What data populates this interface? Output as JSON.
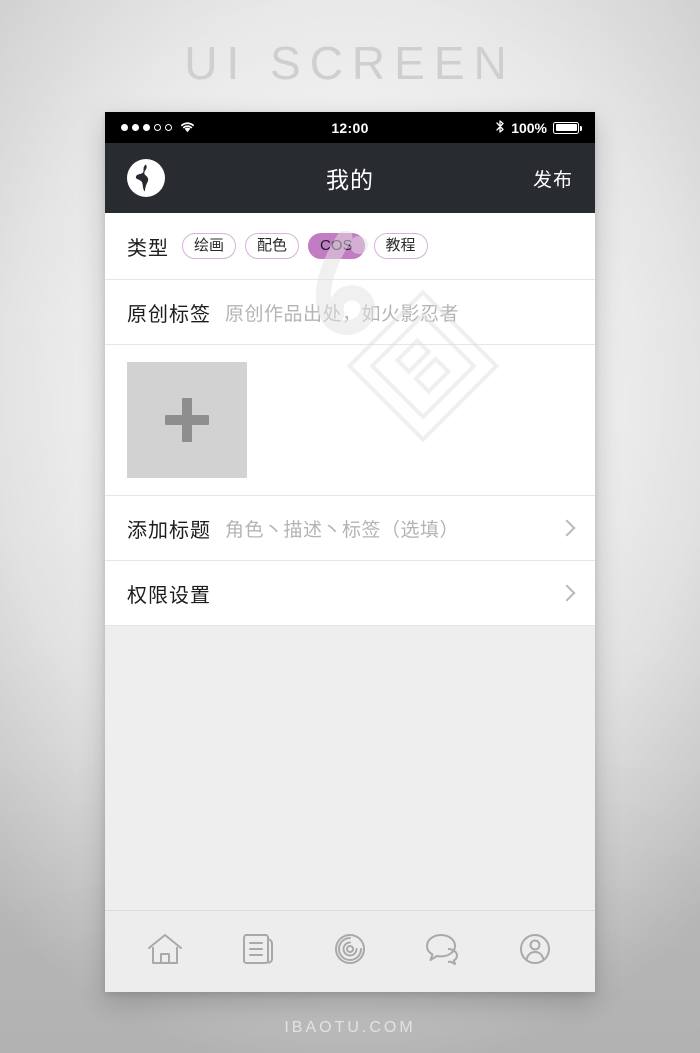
{
  "page": {
    "headline": "UI SCREEN",
    "footer_watermark": "IBAOTU.COM"
  },
  "colors": {
    "accent_purple": "#c27cc4",
    "pill_border": "#d4b4d8",
    "nav_bar": "#282c31",
    "status_bar": "#000000",
    "body_bg": "#eeeeee",
    "card_bg": "#ffffff",
    "upload_box": "#d2d2d2",
    "tab_bar": "#ededed"
  },
  "status_bar": {
    "signal_dots": {
      "filled": 3,
      "hollow": 2
    },
    "wifi_icon": "wifi-icon",
    "time": "12:00",
    "bluetooth_icon": "bluetooth-icon",
    "battery_percent": "100%",
    "battery_icon": "battery-full-icon"
  },
  "nav_bar": {
    "logo_icon": "globe-logo-icon",
    "title": "我的",
    "action_label": "发布"
  },
  "form": {
    "type_row": {
      "label": "类型",
      "pills": [
        {
          "label": "绘画",
          "selected": false
        },
        {
          "label": "配色",
          "selected": false
        },
        {
          "label": "COS",
          "selected": true
        },
        {
          "label": "教程",
          "selected": false
        }
      ]
    },
    "origin_row": {
      "label": "原创标签",
      "placeholder": "原创作品出处，如火影忍者",
      "value": ""
    },
    "upload_row": {
      "add_icon": "plus-icon"
    },
    "title_row": {
      "label": "添加标题",
      "placeholder": "角色丶描述丶标签（选填）",
      "chevron_icon": "chevron-right-icon"
    },
    "permission_row": {
      "label": "权限设置",
      "chevron_icon": "chevron-right-icon"
    }
  },
  "tab_bar": {
    "items": [
      {
        "name": "home",
        "icon": "home-icon"
      },
      {
        "name": "feed",
        "icon": "document-icon"
      },
      {
        "name": "discover",
        "icon": "spiral-target-icon"
      },
      {
        "name": "messages",
        "icon": "chat-bubbles-icon"
      },
      {
        "name": "profile",
        "icon": "user-circle-icon"
      }
    ]
  }
}
